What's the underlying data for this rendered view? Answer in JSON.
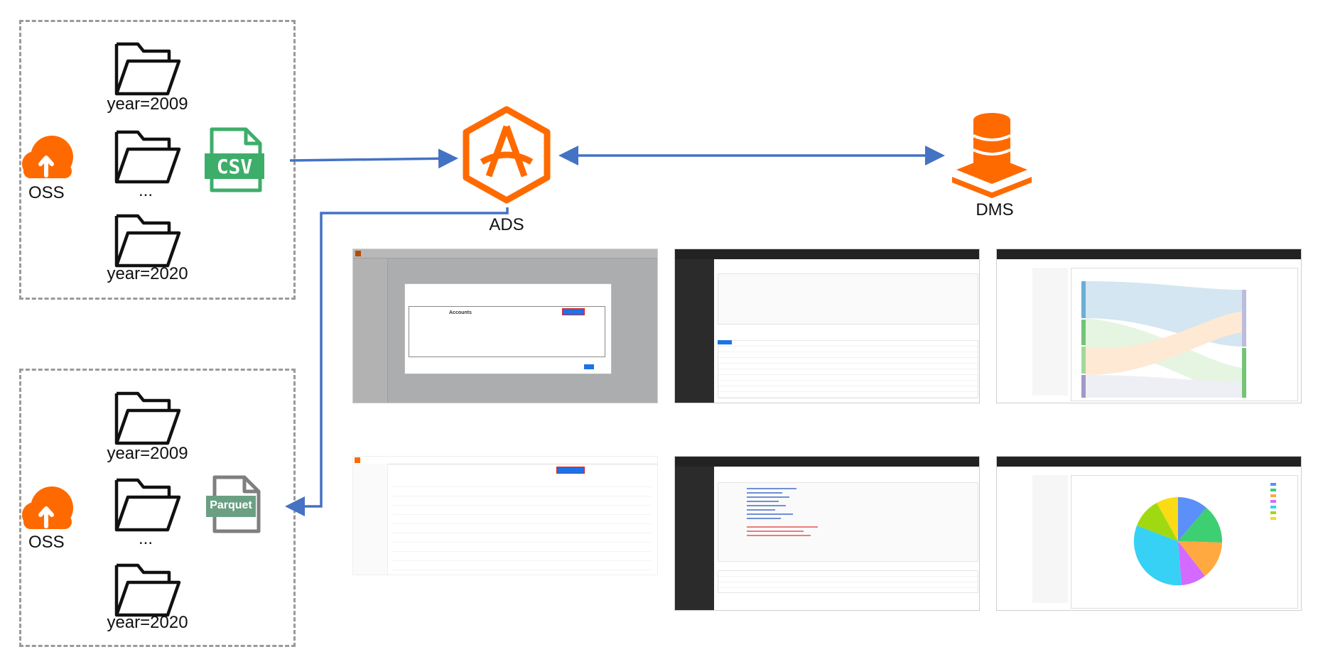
{
  "groups": [
    {
      "service": "OSS",
      "folders": [
        "year=2009",
        "...",
        "year=2020"
      ],
      "file_badge": "CSV",
      "colors": {
        "badge": "#3dae6a"
      }
    },
    {
      "service": "OSS",
      "folders": [
        "year=2009",
        "...",
        "year=2020"
      ],
      "file_badge": "Parquet",
      "colors": {
        "badge": "#6b9f84"
      }
    }
  ],
  "services": {
    "ads": "ADS",
    "dms": "DMS"
  },
  "screens": {
    "ads_console_title": "Accounts",
    "icons": [
      "cloud-upload-icon",
      "folder-icon",
      "csv-file-icon",
      "parquet-file-icon",
      "ads-logo-icon",
      "database-stack-icon"
    ]
  },
  "colors": {
    "accent": "#ff6a00",
    "arrow": "#4472c4",
    "dashed": "#9a9a9a"
  }
}
